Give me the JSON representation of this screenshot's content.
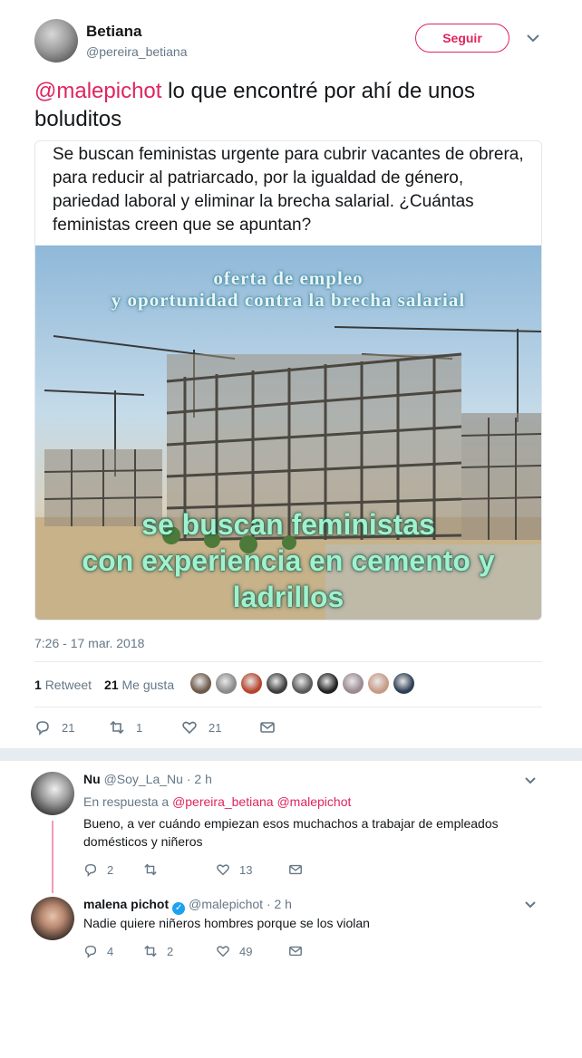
{
  "tweet": {
    "author_name": "Betiana",
    "author_handle": "@pereira_betiana",
    "follow_label": "Seguir",
    "mention": "@malepichot",
    "text": " lo que encontré por ahí   de unos boluditos",
    "quoted_text": "Se buscan feministas urgente para cubrir vacantes de obrera, para reducir al patriarcado, por la igualdad de género, pariedad laboral y eliminar la brecha salarial. ¿Cuántas feministas creen que se apuntan?",
    "image_overlay": {
      "line1": "oferta de empleo",
      "line2": "y oportunidad contra la brecha salarial",
      "line3": "se buscan feministas",
      "line4": "con experiencia en cemento y ladrillos"
    },
    "timestamp": "7:26 - 17 mar. 2018",
    "retweet_count": "1",
    "retweet_label": "Retweet",
    "like_count": "21",
    "like_label": "Me gusta",
    "actions": {
      "replies": "21",
      "retweets": "1",
      "likes": "21"
    },
    "liker_colors": [
      "#6d5a4a",
      "#8a8a8a",
      "#b5442c",
      "#3d3d3d",
      "#5a5a5a",
      "#222222",
      "#9a8a92",
      "#c79a86",
      "#2e3f55"
    ]
  },
  "replies": [
    {
      "name": "Nu",
      "handle": "@Soy_La_Nu",
      "time": "· 2 h",
      "in_reply_label": "En respuesta a",
      "in_reply_users": "@pereira_betiana @malepichot",
      "text": "Bueno, a ver cuándo empiezan esos muchachos a trabajar de empleados domésticos y niñeros",
      "replies": "2",
      "retweets": "",
      "likes": "13"
    },
    {
      "name": "malena pichot",
      "verified": "✓",
      "handle": "@malepichot",
      "time": "· 2 h",
      "text": "Nadie quiere niñeros hombres porque se los violan",
      "replies": "4",
      "retweets": "2",
      "likes": "49"
    }
  ],
  "colors": {
    "accent": "#e0245e",
    "secondary_text": "#657786",
    "verified": "#1da1f2"
  }
}
